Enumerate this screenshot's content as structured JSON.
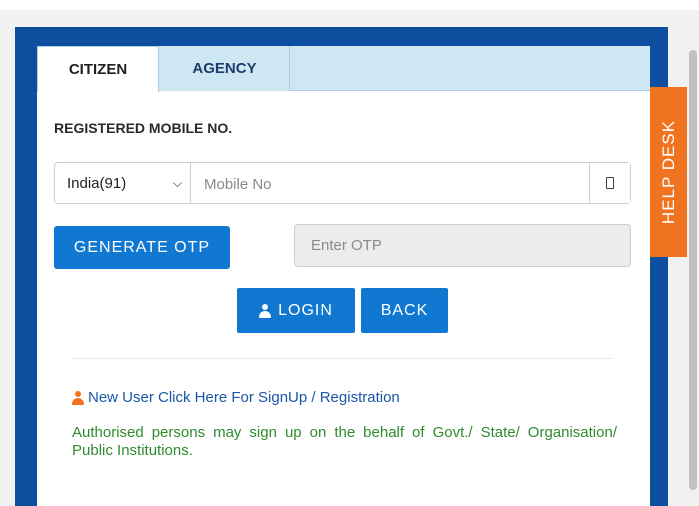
{
  "tabs": [
    {
      "label": "CITIZEN",
      "active": true
    },
    {
      "label": "AGENCY",
      "active": false
    }
  ],
  "form": {
    "mobile_label": "REGISTERED MOBILE NO.",
    "country_selected": "India(91)",
    "mobile_placeholder": "Mobile No",
    "otp_button": "GENERATE OTP",
    "otp_placeholder": "Enter OTP",
    "login_button": "LOGIN",
    "back_button": "BACK"
  },
  "signup": {
    "link_text": "New User Click Here For SignUp / Registration",
    "note": "Authorised persons may sign up on the behalf of Govt./ State/ Organisation/ Public Institutions."
  },
  "help_desk": {
    "label": "HELP DESK"
  },
  "icons": {
    "country_chevron": "chevron-down-icon",
    "mobile_addon": "mobile-phone-icon",
    "login": "user-icon",
    "signup": "user-icon"
  },
  "colors": {
    "frame": "#0d4f9e",
    "tab_bar": "#cde8f3",
    "button": "#1178d2",
    "help_desk": "#f07320",
    "link": "#1a57a8",
    "note": "#2e8b2e"
  }
}
